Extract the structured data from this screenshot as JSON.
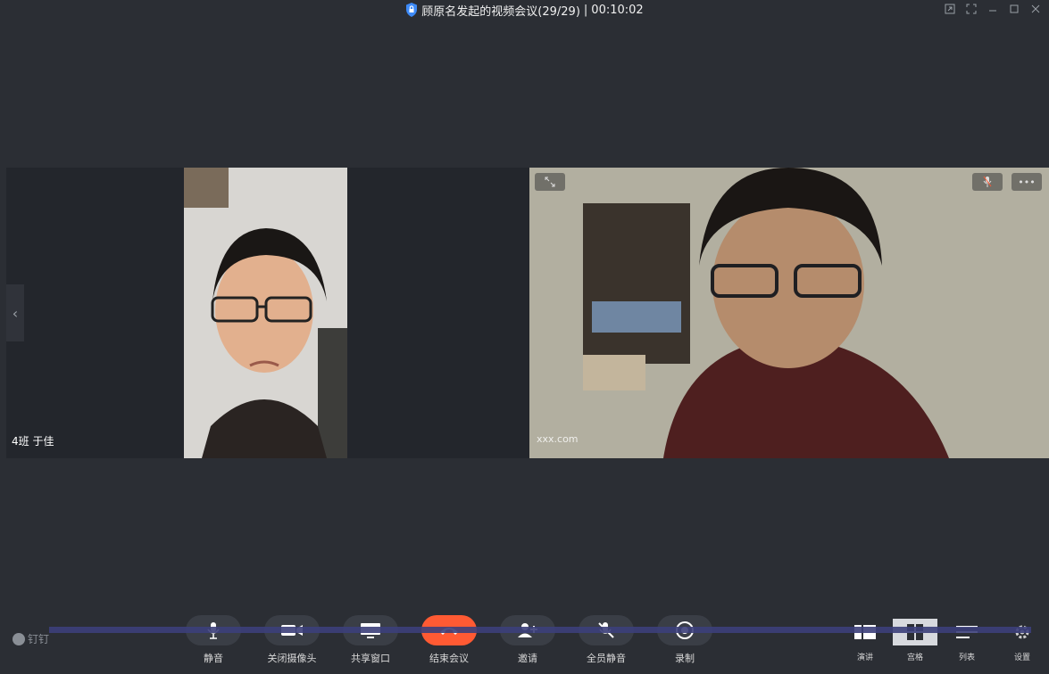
{
  "window": {
    "title": "顾原名发起的视频会议(29/29)",
    "timer": "00:10:02"
  },
  "tiles": {
    "tile1_name": "4班 于佳",
    "tile2_name": "xxx.com"
  },
  "toolbar": {
    "brand": "钉钉",
    "mute": "静音",
    "camera_off": "关闭摄像头",
    "share_window": "共享窗口",
    "end_meeting": "结束会议",
    "invite": "邀请",
    "mute_all": "全员静音",
    "record": "录制",
    "view_speaker": "演讲",
    "view_grid": "宫格",
    "view_list": "列表",
    "settings": "设置"
  },
  "colors": {
    "end_button": "#ff5a33",
    "background": "#2b2e34"
  }
}
